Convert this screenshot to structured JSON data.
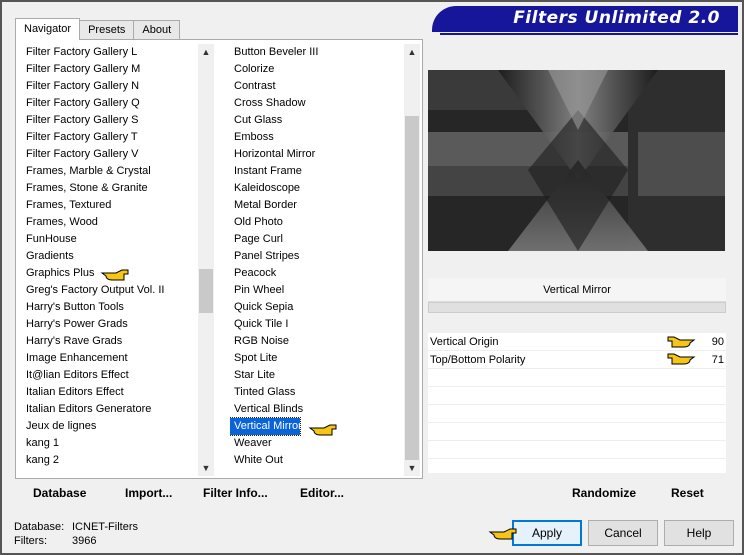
{
  "window": {
    "title": "Filters Unlimited 2.0"
  },
  "tabs": [
    {
      "label": "Navigator",
      "active": true
    },
    {
      "label": "Presets",
      "active": false
    },
    {
      "label": "About",
      "active": false
    }
  ],
  "categories": [
    "Filter Factory Gallery L",
    "Filter Factory Gallery M",
    "Filter Factory Gallery N",
    "Filter Factory Gallery Q",
    "Filter Factory Gallery S",
    "Filter Factory Gallery T",
    "Filter Factory Gallery V",
    "Frames, Marble & Crystal",
    "Frames, Stone & Granite",
    "Frames, Textured",
    "Frames, Wood",
    "FunHouse",
    "Gradients",
    "Graphics Plus",
    "Greg's Factory Output Vol. II",
    "Harry's Button Tools",
    "Harry's Power Grads",
    "Harry's Rave Grads",
    "Image Enhancement",
    "It@lian Editors Effect",
    "Italian Editors Effect",
    "Italian Editors Generatore",
    "Jeux de lignes",
    "kang 1",
    "kang 2"
  ],
  "filters": [
    "Button Beveler III",
    "Colorize",
    "Contrast",
    "Cross Shadow",
    "Cut Glass",
    "Emboss",
    "Horizontal Mirror",
    "Instant Frame",
    "Kaleidoscope",
    "Metal Border",
    "Old Photo",
    "Page Curl",
    "Panel Stripes",
    "Peacock",
    "Pin Wheel",
    "Quick Sepia",
    "Quick Tile I",
    "RGB Noise",
    "Spot Lite",
    "Star Lite",
    "Tinted Glass",
    "Vertical Blinds",
    "Vertical Mirror",
    "Weaver",
    "White Out"
  ],
  "selected_filter_index": 22,
  "left_buttons": {
    "database": "Database",
    "import": "Import...",
    "filter_info": "Filter Info...",
    "editor": "Editor..."
  },
  "filter_panel": {
    "name": "Vertical Mirror",
    "params": [
      {
        "label": "Vertical Origin",
        "value": "90"
      },
      {
        "label": "Top/Bottom Polarity",
        "value": "71"
      }
    ],
    "randomize": "Randomize",
    "reset": "Reset"
  },
  "status": {
    "database_label": "Database:",
    "database_value": "ICNET-Filters",
    "filters_label": "Filters:",
    "filters_value": "3966"
  },
  "buttons": {
    "apply": "Apply",
    "cancel": "Cancel",
    "help": "Help"
  },
  "colors": {
    "banner": "#16169a",
    "selection": "#0a64d8",
    "hand": "#f5c518"
  },
  "icons": {
    "pointer": "pointing-hand-icon"
  }
}
